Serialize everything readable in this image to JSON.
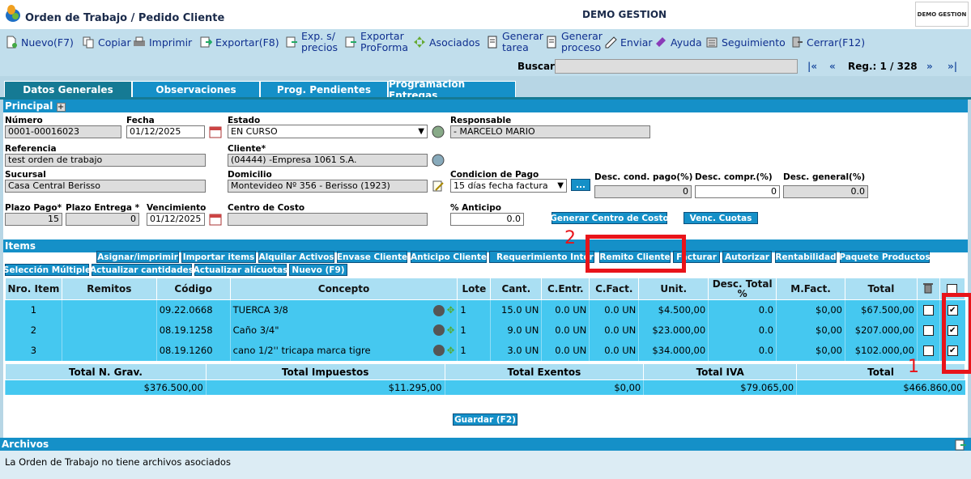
{
  "header": {
    "title": "Orden de Trabajo / Pedido Cliente",
    "company": "DEMO GESTION",
    "brand_logo": "DEMO GESTION"
  },
  "toolbar": {
    "nuevo": "Nuevo(F7)",
    "copiar": "Copiar",
    "imprimir": "Imprimir",
    "exportar": "Exportar(F8)",
    "exp1": "Exp. s/",
    "exp2": "precios",
    "expf1": "Exportar",
    "expf2": "ProForma",
    "asociados": "Asociados",
    "gt1": "Generar",
    "gt2": "tarea",
    "gp1": "Generar",
    "gp2": "proceso",
    "enviar": "Enviar",
    "ayuda": "Ayuda",
    "seguimiento": "Seguimiento",
    "cerrar": "Cerrar(F12)"
  },
  "search": {
    "label": "Buscar",
    "value": "",
    "reg": "Reg.: 1 / 328",
    "first": "|«",
    "prev": "«",
    "next": "»",
    "last": "»|"
  },
  "tabs": [
    "Datos Generales",
    "Observaciones",
    "Prog. Pendientes",
    "Programacion Entregas"
  ],
  "principal": {
    "title": "Principal",
    "numero_label": "Número",
    "numero": "0001-00016023",
    "fecha_label": "Fecha",
    "fecha": "01/12/2025",
    "estado_label": "Estado",
    "estado": "EN CURSO",
    "responsable_label": "Responsable",
    "responsable": "- MARCELO MARIO",
    "referencia_label": "Referencia",
    "referencia": "test orden de trabajo",
    "cliente_label": "Cliente*",
    "cliente": "(04444) -Empresa 1061 S.A.",
    "sucursal_label": "Sucursal",
    "sucursal": "Casa Central Berisso",
    "domicilio_label": "Domicilio",
    "domicilio": "Montevideo Nº 356 - Berisso (1923)",
    "condicion_label": "Condicion de Pago",
    "condicion": "15 días fecha factura",
    "dots": "...",
    "desc_cond_label": "Desc. cond. pago(%)",
    "desc_cond": "0",
    "desc_compr_label": "Desc. compr.(%)",
    "desc_compr": "0",
    "desc_gral_label": "Desc. general(%)",
    "desc_gral": "0.0",
    "plazo_pago_label": "Plazo Pago*",
    "plazo_pago": "15",
    "plazo_entrega_label": "Plazo Entrega *",
    "plazo_entrega": "0",
    "vencimiento_label": "Vencimiento",
    "vencimiento": "01/12/2025",
    "centro_label": "Centro de Costo",
    "centro": "",
    "anticipo_label": "% Anticipo",
    "anticipo": "0.0",
    "gen_centro": "Generar Centro de Costo",
    "venc_cuotas": "Venc. Cuotas"
  },
  "items": {
    "title": "Items",
    "buttons1": [
      "Asignar/imprimir",
      "Importar items",
      "Alquilar Activos",
      "Envase Cliente",
      "Anticipo Cliente",
      "Requerimiento Intern",
      "Remito Cliente",
      "Facturar",
      "Autorizar",
      "Rentabilidad",
      "Paquete Productos"
    ],
    "buttons2": [
      "Selección Múltiple",
      "Actualizar cantidades",
      "Actualizar alícuotas",
      "Nuevo (F9)"
    ],
    "columns": [
      "Nro. Item",
      "Remitos",
      "Código",
      "Concepto",
      "Lote",
      "Cant.",
      "C.Entr.",
      "C.Fact.",
      "Unit.",
      "Desc. Total %",
      "M.Fact.",
      "Total"
    ],
    "rows": [
      {
        "nro": "1",
        "remitos": "",
        "codigo": "09.22.0668",
        "concepto": "TUERCA 3/8",
        "lote": "1",
        "cant": "15.0 UN",
        "centr": "0.0 UN",
        "cfact": "0.0 UN",
        "unit": "$4.500,00",
        "desc": "0.0",
        "mfact": "$0,00",
        "total": "$67.500,00"
      },
      {
        "nro": "2",
        "remitos": "",
        "codigo": "08.19.1258",
        "concepto": "Caño 3/4\"",
        "lote": "1",
        "cant": "9.0 UN",
        "centr": "0.0 UN",
        "cfact": "0.0 UN",
        "unit": "$23.000,00",
        "desc": "0.0",
        "mfact": "$0,00",
        "total": "$207.000,00"
      },
      {
        "nro": "3",
        "remitos": "",
        "codigo": "08.19.1260",
        "concepto": "cano 1/2'' tricapa marca tigre",
        "lote": "1",
        "cant": "3.0 UN",
        "centr": "0.0 UN",
        "cfact": "0.0 UN",
        "unit": "$34.000,00",
        "desc": "0.0",
        "mfact": "$0,00",
        "total": "$102.000,00"
      }
    ]
  },
  "totals": {
    "labels": [
      "Total N. Grav.",
      "Total Impuestos",
      "Total Exentos",
      "Total IVA",
      "Total"
    ],
    "values": [
      "$376.500,00",
      "$11.295,00",
      "$0,00",
      "$79.065,00",
      "$466.860,00"
    ]
  },
  "guardar": "Guardar (F2)",
  "archivos": {
    "title": "Archivos",
    "text": "La Orden de Trabajo no tiene archivos asociados"
  },
  "annotations": {
    "one": "1",
    "two": "2"
  }
}
